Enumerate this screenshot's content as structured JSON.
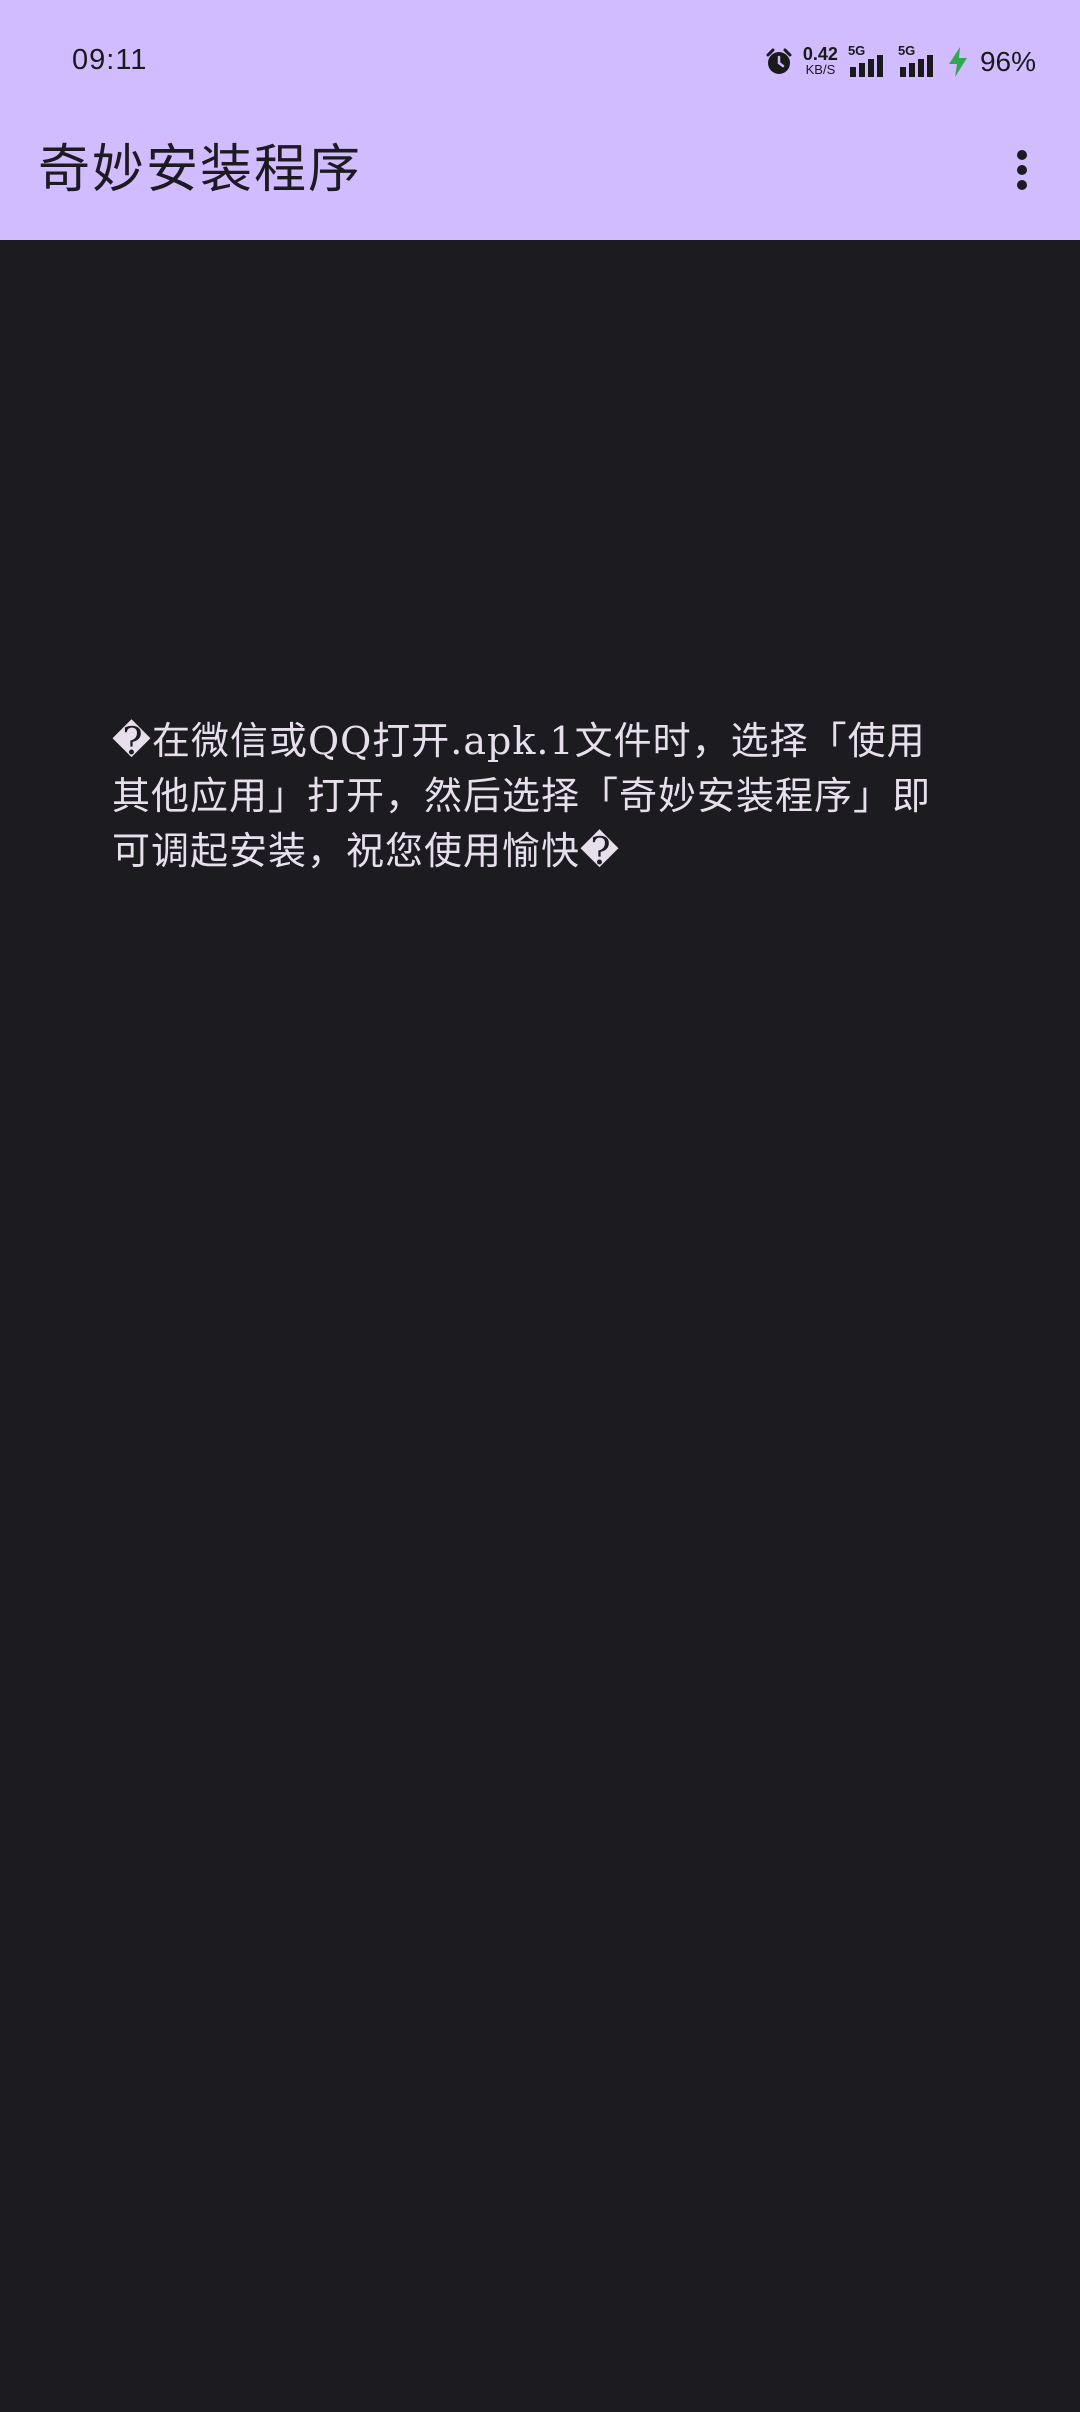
{
  "status_bar": {
    "time": "09:11",
    "net_speed_value": "0.42",
    "net_speed_unit": "KB/S",
    "signal_1_label": "5G",
    "signal_2_label": "5G",
    "battery": "96%",
    "colors": {
      "background": "#d0bcfe",
      "charging": "#2fa84f"
    }
  },
  "app_bar": {
    "title": "奇妙安装程序",
    "overflow_icon": "more-vert-icon"
  },
  "content": {
    "message": "�在微信或QQ打开.apk.1文件时，选择「使用其他应用」打开，然后选择「奇妙安装程序」即可调起安装，祝您使用愉快�"
  },
  "theme": {
    "primary": "#d0bcfe",
    "background": "#1c1b20",
    "on_background": "#e7e0ec"
  }
}
